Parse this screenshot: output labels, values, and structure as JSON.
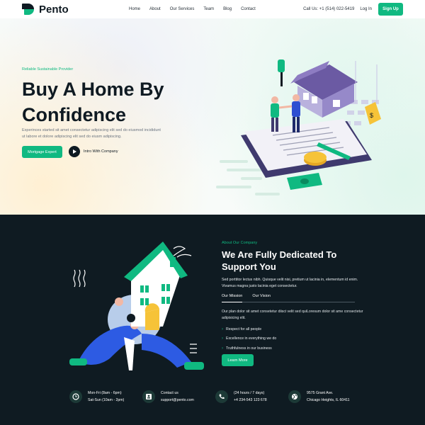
{
  "brand": {
    "name": "Pento"
  },
  "nav": {
    "items": [
      "Home",
      "About",
      "Our Services",
      "Team",
      "Blog",
      "Contact"
    ],
    "call": "Call Us: +1 (514) 022-5419",
    "login": "Log In",
    "signup": "Sign Up"
  },
  "hero": {
    "tagline": "Reliable Sustainable Provider",
    "title_line1": "Buy A Home By",
    "title_line2": "Confidence",
    "description": "Experinces started sit amet consectetur adipiscing elit sed do eiusmod incididunt ut labore et dolore adipiscing elit sed do eiusm adipiscing.",
    "primary_button": "Mortgage Expert",
    "intro_label": "Intro With Company"
  },
  "about": {
    "tag": "About Our Company",
    "title_line1": "We Are Fully Dedicated To",
    "title_line2": "Support You",
    "description": "Sed porttitor lectus nibh. Quisque velit nisi, pretium ut lacinia in, elementum id enim. Vivamus magna justo lacinia eget consectetur.",
    "tabs": [
      "Our Mission",
      "Our Vision"
    ],
    "tab_content": "Our plan dolor sit amet consetetur diisci velit sed quiLoresum dolor sit ame consectetur adipisicing elit.",
    "bullets": [
      "Respect for all people",
      "Excellence in everything we do",
      "Truthfulness in our business"
    ],
    "button": "Learn More"
  },
  "contacts": [
    {
      "icon": "clock-icon",
      "line1": "Mon-Fri (8am - 6pm)",
      "line2": "Sat-Sun (10am - 2pm)"
    },
    {
      "icon": "contact-card-icon",
      "line1": "Contact us",
      "line2": "support@pento.com"
    },
    {
      "icon": "phone-icon",
      "line1": "(24 hours / 7 days)",
      "line2": "+4 234-543 123 678"
    },
    {
      "icon": "globe-icon",
      "line1": "9575 Grant Ave.",
      "line2": "Chicago Heights, IL 60411"
    }
  ],
  "colors": {
    "accent": "#10b981",
    "dark": "#0f1b22",
    "heading": "#0f1a22"
  }
}
